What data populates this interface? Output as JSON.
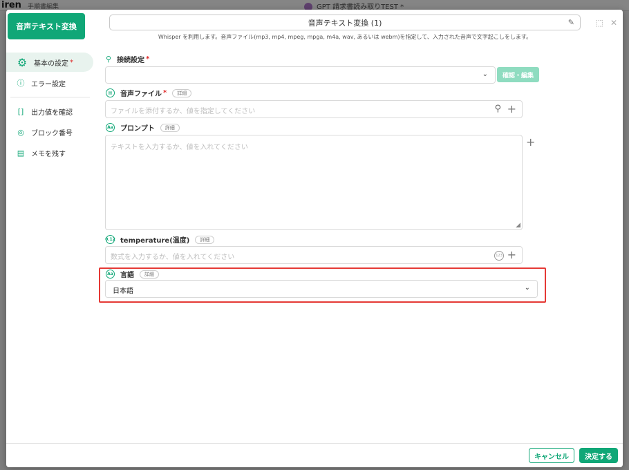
{
  "background": {
    "logo": "iren",
    "subtitle": "手順書編集",
    "title": "GPT 請求書読み取りTEST",
    "title_mark": "*"
  },
  "modal": {
    "block_name": "音声テキスト変換",
    "title_value": "音声テキスト変換 (1)",
    "description": "Whisper を利用します。音声ファイル(mp3, mp4, mpeg, mpga, m4a, wav, あるいは webm)を指定して、入力された音声で文字起こしをします。"
  },
  "sidebar": {
    "items": [
      {
        "label": "基本の設定",
        "icon": "gear-icon",
        "required": "*"
      },
      {
        "label": "エラー設定",
        "icon": "info-icon"
      },
      {
        "label": "出力値を確認",
        "icon": "bracket-icon"
      },
      {
        "label": "ブロック番号",
        "icon": "number-icon"
      },
      {
        "label": "メモを残す",
        "icon": "memo-icon"
      }
    ]
  },
  "form": {
    "connection": {
      "label": "接続設定",
      "required": "*",
      "button": "確認・編集"
    },
    "audio_file": {
      "label": "音声ファイル",
      "required": "*",
      "detail": "詳細",
      "placeholder": "ファイルを添付するか、値を指定してください"
    },
    "prompt": {
      "label": "プロンプト",
      "detail": "詳細",
      "placeholder": "テキストを入力するか、値を入れてください"
    },
    "temperature": {
      "label": "temperature(温度)",
      "detail": "詳細",
      "placeholder": "数式を入力するか、値を入れてください"
    },
    "language": {
      "label": "言語",
      "detail": "詳細",
      "value": "日本語"
    }
  },
  "footer": {
    "cancel": "キャンセル",
    "confirm": "決定する"
  },
  "colors": {
    "accent": "#10a777",
    "highlight": "#e53935",
    "required": "#e02424"
  }
}
